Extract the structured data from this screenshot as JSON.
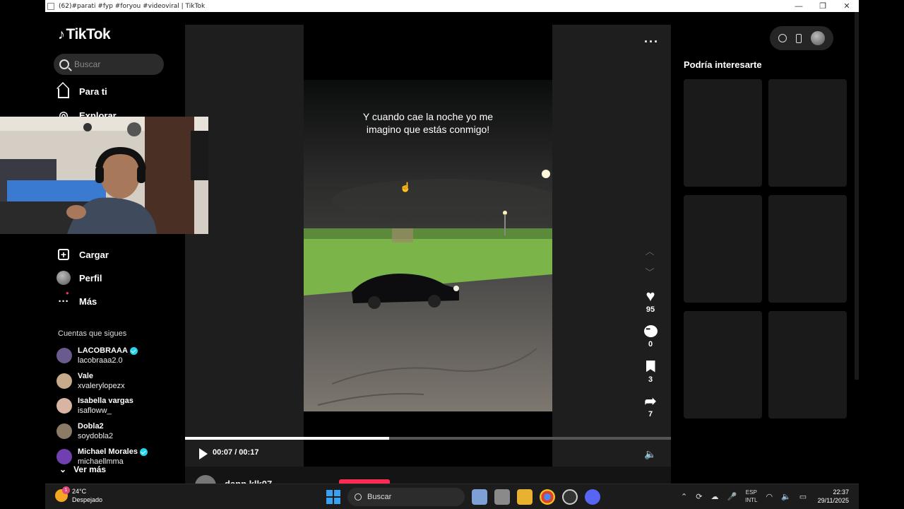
{
  "window": {
    "title": "(62)#parati #fyp #foryou #videoviral | TikTok",
    "minimize": "—",
    "restore": "❐",
    "close": "✕"
  },
  "sidebar": {
    "logo_text": "TikTok",
    "search_placeholder": "Buscar",
    "nav": [
      {
        "label": "Para ti",
        "icon": "home-icon"
      },
      {
        "label": "Explorar",
        "icon": "compass-icon"
      },
      {
        "label": "Cargar",
        "icon": "upload-icon"
      },
      {
        "label": "Perfil",
        "icon": "profile-avatar"
      },
      {
        "label": "Más",
        "icon": "more-icon"
      }
    ],
    "following_title": "Cuentas que sigues",
    "following": [
      {
        "name": "LACOBRAAA",
        "handle": "lacobraaa2.0",
        "verified": true,
        "color": "#6b5a8e"
      },
      {
        "name": "Vale",
        "handle": "xvalerylopezx",
        "verified": false,
        "color": "#c7a98c"
      },
      {
        "name": "Isabella vargas",
        "handle": "isafloww_",
        "verified": false,
        "color": "#d8b4a2"
      },
      {
        "name": "Dobla2",
        "handle": "soydobla2",
        "verified": false,
        "color": "#8a7a66"
      },
      {
        "name": "Michael Morales",
        "handle": "michaellmma",
        "verified": true,
        "color": "#7040b0"
      }
    ],
    "see_more": "Ver más"
  },
  "video": {
    "caption": "Y cuando cae la noche yo me imagino que estás conmigo!",
    "likes": "95",
    "comments": "0",
    "saves": "3",
    "shares": "7",
    "time": "00:07 / 00:17",
    "progress": 0.42,
    "author": "dann.klk07"
  },
  "right": {
    "title": "Podría interesarte"
  },
  "taskbar": {
    "temp": "24°C",
    "condition": "Despejado",
    "search": "Buscar",
    "lang1": "ESP",
    "lang2": "INTL",
    "time": "22:37",
    "date": "29/11/2025",
    "weather_badge": "1"
  }
}
